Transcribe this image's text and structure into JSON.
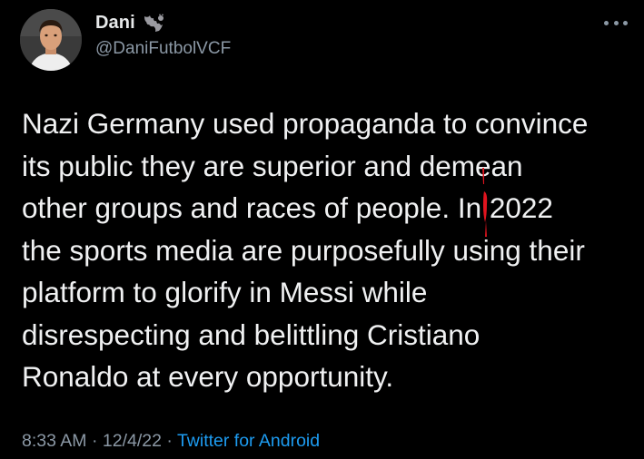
{
  "author": {
    "display_name": "Dani",
    "handle": "@DaniFutbolVCF",
    "avatar_icon": "profile-photo",
    "badge_icon": "bat-icon"
  },
  "tweet": {
    "text": "Nazi Germany used propaganda to convince\nits public they are superior and demean\nother groups and races of people. In 2022\nthe sports media are purposefully using their\nplatform to glorify in Messi while\ndisrespecting and belittling Cristiano\nRonaldo at every opportunity."
  },
  "meta": {
    "time": "8:33 AM",
    "separator": " · ",
    "date": "12/4/22",
    "source": "Twitter for Android"
  },
  "menu": {
    "icon": "more-horizontal-icon"
  },
  "colors": {
    "background": "#000000",
    "text": "#e7e9ea",
    "secondary": "#8b98a5",
    "link": "#1d9bf0",
    "annotation": "#e0141e"
  }
}
